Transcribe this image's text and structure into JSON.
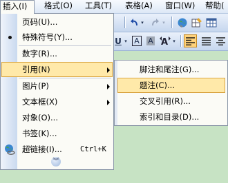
{
  "menubar": {
    "items": [
      {
        "label": "插入(I)"
      },
      {
        "label": "格式(O)"
      },
      {
        "label": "工具(T)"
      },
      {
        "label": "表格(A)"
      },
      {
        "label": "窗口(W)"
      },
      {
        "label": "帮助("
      }
    ]
  },
  "insert_menu": {
    "items": [
      {
        "label": "页码(U)...",
        "icon": "page-number-icon"
      },
      {
        "label": "特殊符号(Y)...",
        "icon": "bullet-icon"
      },
      {
        "label": "数字(R)..."
      },
      {
        "label": "引用(N)",
        "submenu": true,
        "highlighted": true
      },
      {
        "label": "图片(P)",
        "submenu": true
      },
      {
        "label": "文本框(X)",
        "submenu": true
      },
      {
        "label": "对象(O)..."
      },
      {
        "label": "书签(K)..."
      },
      {
        "label": "超链接(I)...",
        "shortcut": "Ctrl+K",
        "icon": "globe-link-icon"
      }
    ],
    "expand_icon": "double-chevron-down-icon"
  },
  "reference_submenu": {
    "items": [
      {
        "label": "脚注和尾注(G)..."
      },
      {
        "label": "题注(C)...",
        "highlighted": true
      },
      {
        "label": "交叉引用(R)..."
      },
      {
        "label": "索引和目录(D)..."
      }
    ]
  },
  "toolbar": {
    "font_size_letter": "A",
    "char_scale_letter": "A",
    "undo_icon": "undo-icon",
    "redo_icon": "redo-icon"
  },
  "colors": {
    "menu_bg": "#fbfbf6",
    "highlight": "#ffe9a9",
    "highlight_border": "#d9a440",
    "doc_bg": "#c7e3c4"
  }
}
